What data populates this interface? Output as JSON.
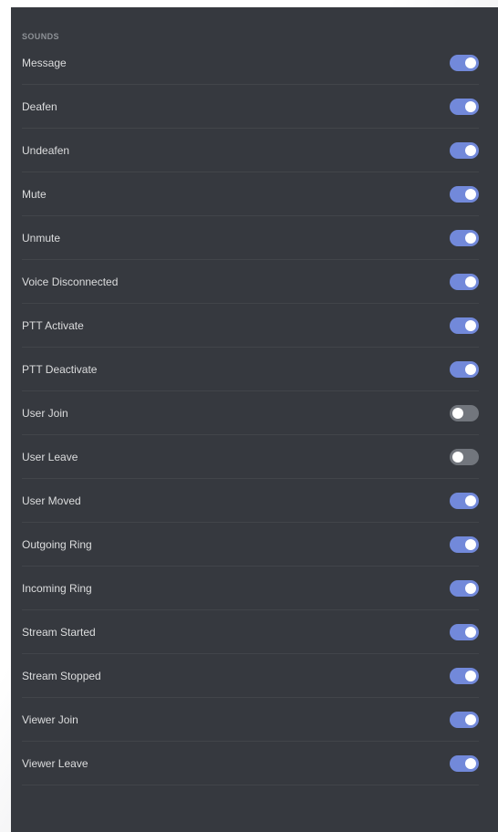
{
  "section": {
    "title": "SOUNDS"
  },
  "colors": {
    "panel_bg": "#36393f",
    "toggle_on": "#7289da",
    "toggle_off": "#72767d",
    "divider": "#42454a"
  },
  "sounds": [
    {
      "label": "Message",
      "enabled": true
    },
    {
      "label": "Deafen",
      "enabled": true
    },
    {
      "label": "Undeafen",
      "enabled": true
    },
    {
      "label": "Mute",
      "enabled": true
    },
    {
      "label": "Unmute",
      "enabled": true
    },
    {
      "label": "Voice Disconnected",
      "enabled": true
    },
    {
      "label": "PTT Activate",
      "enabled": true
    },
    {
      "label": "PTT Deactivate",
      "enabled": true
    },
    {
      "label": "User Join",
      "enabled": false
    },
    {
      "label": "User Leave",
      "enabled": false
    },
    {
      "label": "User Moved",
      "enabled": true
    },
    {
      "label": "Outgoing Ring",
      "enabled": true
    },
    {
      "label": "Incoming Ring",
      "enabled": true
    },
    {
      "label": "Stream Started",
      "enabled": true
    },
    {
      "label": "Stream Stopped",
      "enabled": true
    },
    {
      "label": "Viewer Join",
      "enabled": true
    },
    {
      "label": "Viewer Leave",
      "enabled": true
    }
  ]
}
